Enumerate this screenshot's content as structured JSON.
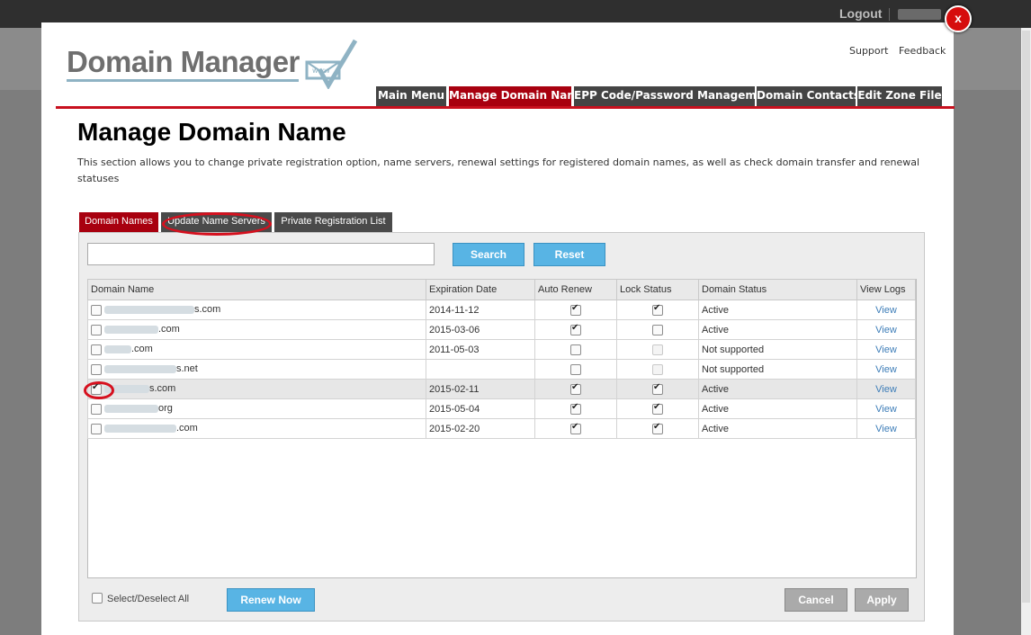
{
  "header": {
    "logout_label": "Logout"
  },
  "brand": {
    "name": "Domain Manager",
    "icon_text": "www"
  },
  "toplinks": {
    "support": "Support",
    "feedback": "Feedback"
  },
  "nav_tabs": [
    {
      "label": "Main Menu",
      "active": false
    },
    {
      "label": "Manage Domain Name",
      "active": true
    },
    {
      "label": "EPP Code/Password Management",
      "active": false
    },
    {
      "label": "Domain Contacts",
      "active": false
    },
    {
      "label": "Edit Zone File",
      "active": false
    }
  ],
  "page": {
    "title": "Manage Domain Name",
    "description": "This section allows you to change private registration option, name servers, renewal settings for registered domain names, as well as check domain transfer and renewal statuses"
  },
  "sub_tabs": [
    {
      "label": "Domain Names",
      "active": true
    },
    {
      "label": "Update Name Servers",
      "active": false
    },
    {
      "label": "Private Registration List",
      "active": false
    }
  ],
  "search": {
    "value": "",
    "placeholder": "",
    "search_label": "Search",
    "reset_label": "Reset"
  },
  "table": {
    "columns": [
      "Domain Name",
      "Expiration Date",
      "Auto Renew",
      "Lock Status",
      "Domain Status",
      "View Logs"
    ],
    "rows": [
      {
        "selected": false,
        "domain_suffix": "s.com",
        "expiration": "2014-11-12",
        "auto_renew": true,
        "lock": true,
        "lock_enabled": true,
        "status": "Active",
        "logs": "View"
      },
      {
        "selected": false,
        "domain_suffix": ".com",
        "expiration": "2015-03-06",
        "auto_renew": true,
        "lock": false,
        "lock_enabled": true,
        "status": "Active",
        "logs": "View"
      },
      {
        "selected": false,
        "domain_suffix": ".com",
        "expiration": "2011-05-03",
        "auto_renew": false,
        "lock": false,
        "lock_enabled": false,
        "status": "Not supported",
        "logs": "View"
      },
      {
        "selected": false,
        "domain_suffix": "s.net",
        "expiration": "",
        "auto_renew": false,
        "lock": false,
        "lock_enabled": false,
        "status": "Not supported",
        "logs": "View"
      },
      {
        "selected": true,
        "domain_suffix": "s.com",
        "expiration": "2015-02-11",
        "auto_renew": true,
        "lock": true,
        "lock_enabled": true,
        "status": "Active",
        "logs": "View"
      },
      {
        "selected": false,
        "domain_suffix": "org",
        "expiration": "2015-05-04",
        "auto_renew": true,
        "lock": true,
        "lock_enabled": true,
        "status": "Active",
        "logs": "View"
      },
      {
        "selected": false,
        "domain_suffix": ".com",
        "expiration": "2015-02-20",
        "auto_renew": true,
        "lock": true,
        "lock_enabled": true,
        "status": "Active",
        "logs": "View"
      }
    ]
  },
  "footer": {
    "select_all_label": "Select/Deselect All",
    "renew_label": "Renew Now",
    "cancel_label": "Cancel",
    "apply_label": "Apply"
  },
  "colors": {
    "accent_red": "#a8000f",
    "button_blue": "#58b4e4",
    "link_blue": "#3d7db8"
  }
}
